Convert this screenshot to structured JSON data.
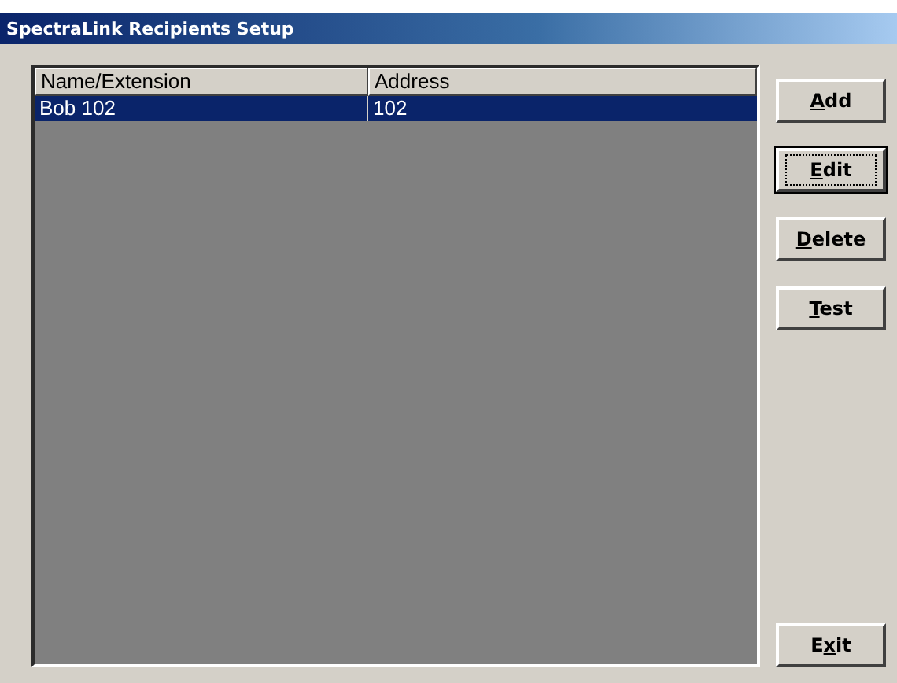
{
  "window": {
    "title": "SpectraLink Recipients Setup"
  },
  "table": {
    "columns": [
      "Name/Extension",
      "Address"
    ],
    "rows": [
      {
        "cells": [
          "Bob 102",
          "102"
        ],
        "selected": true
      }
    ]
  },
  "buttons": [
    {
      "key": "A",
      "post": "dd",
      "focused": false
    },
    {
      "key": "E",
      "post": "dit",
      "focused": true
    },
    {
      "key": "D",
      "post": "elete",
      "focused": false
    },
    {
      "key": "T",
      "post": "est",
      "focused": false
    },
    {
      "pre": "E",
      "key": "x",
      "post": "it",
      "focused": false
    }
  ]
}
